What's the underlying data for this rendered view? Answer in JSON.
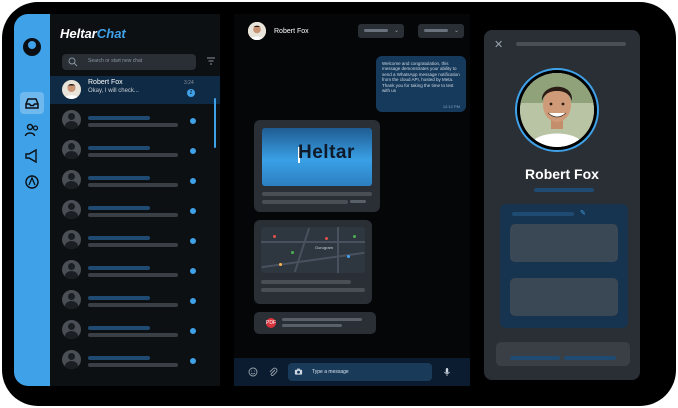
{
  "app": {
    "logo_first": "Heltar",
    "logo_second": "Chat"
  },
  "search": {
    "placeholder": "Search or start new chat"
  },
  "chat_list": {
    "selected": {
      "name": "Robert Fox",
      "preview": "Okay, I will check...",
      "time": "3:24",
      "unread": "2"
    }
  },
  "conversation": {
    "contact_name": "Robert Fox",
    "incoming_message": "Welcome and congratulation, this message demonstrates your ability to send a WhatsApp message notification from the cloud API, hosted by Meta. Thank you for taking the time to test with us",
    "incoming_time": "12:12 PM",
    "banner_text": "Heltar",
    "map_label": "Gurugram",
    "pdf_label": "PDF",
    "composer_placeholder": "Type a message"
  },
  "profile": {
    "name": "Robert Fox"
  },
  "colors": {
    "accent": "#3fa2e8",
    "background": "#000000",
    "panel": "#2a2f36"
  }
}
